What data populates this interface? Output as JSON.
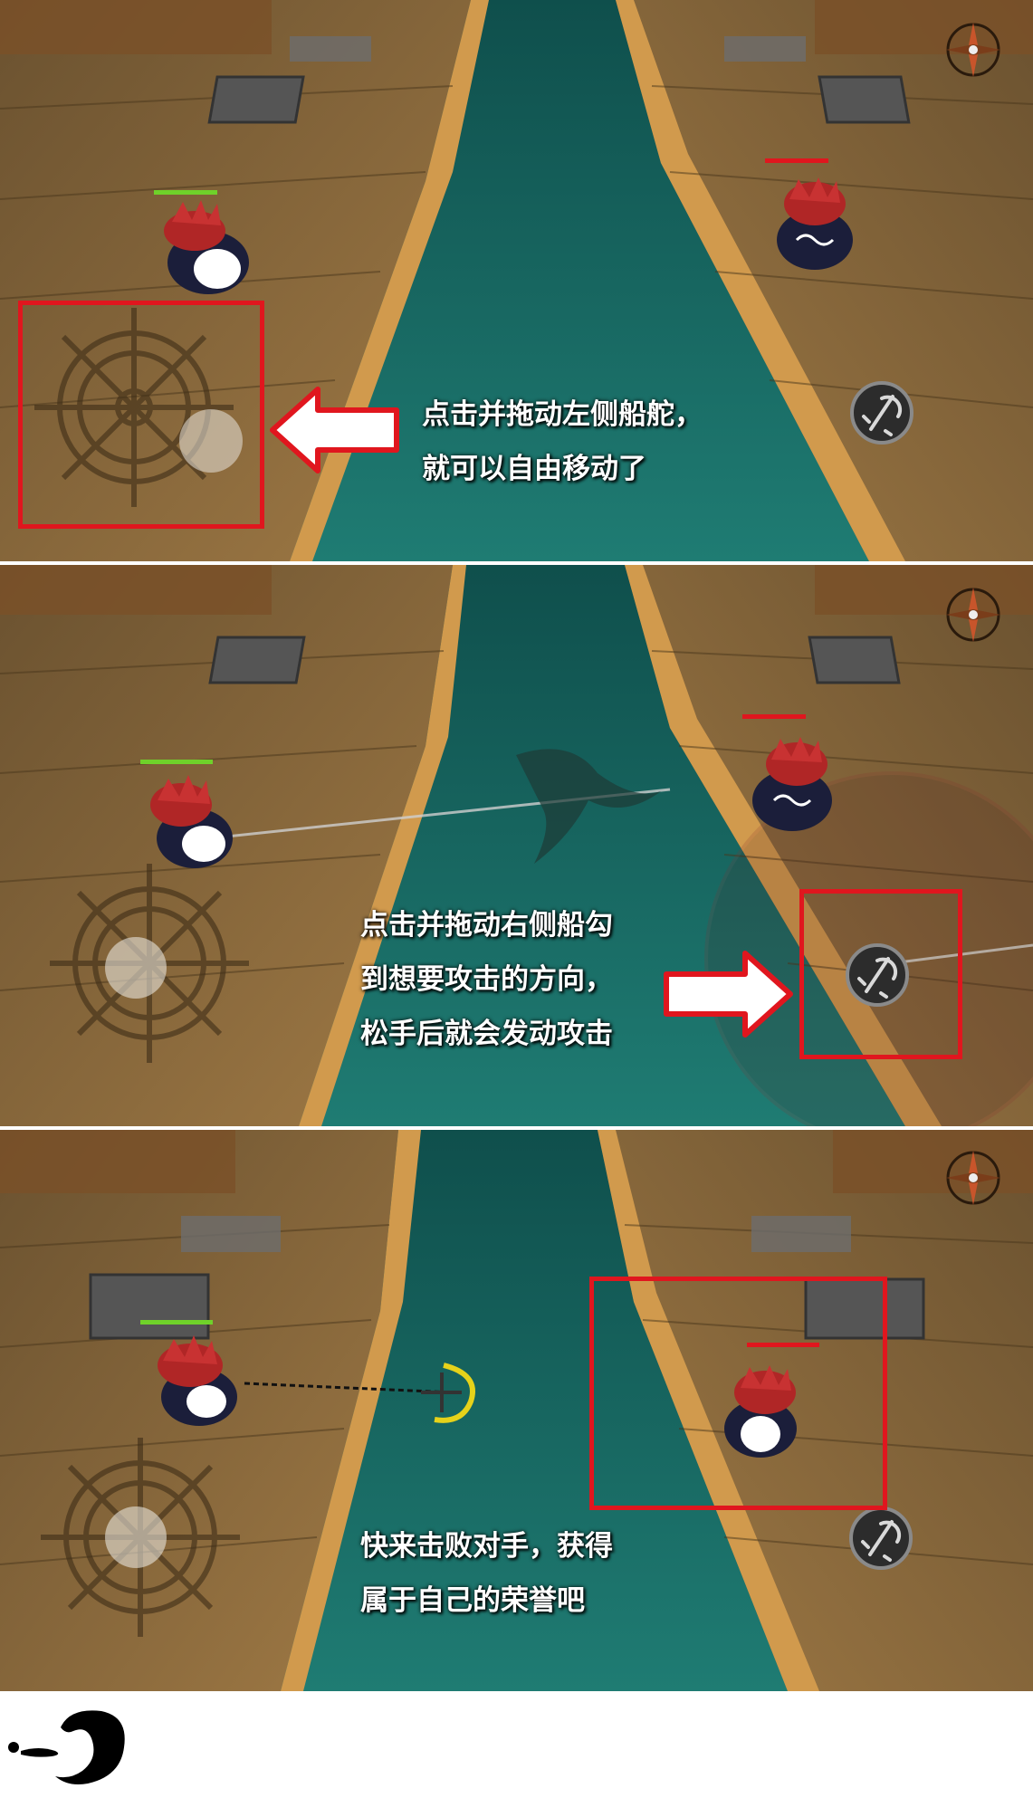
{
  "tutorial": {
    "step1_caption": [
      "点击并拖动左侧船舵，",
      "就可以自由移动了"
    ],
    "step2_caption": [
      "点击并拖动右侧船勾",
      "到想要攻击的方向，",
      "松手后就会发动攻击"
    ],
    "step3_caption": [
      "快来击败对手，获得",
      "属于自己的荣誉吧"
    ]
  },
  "colors": {
    "highlight": "#e0161e",
    "player_health": "#6fd12a",
    "enemy_health": "#e0161e",
    "sea": "#1d6e68",
    "deck": "#8a6a3c"
  },
  "icons": [
    "ship-wheel-joystick-icon",
    "anchor-hook-attack-icon",
    "compass-rose-icon",
    "arrow-right-icon",
    "arrow-left-icon",
    "brush-stroke-logo"
  ]
}
